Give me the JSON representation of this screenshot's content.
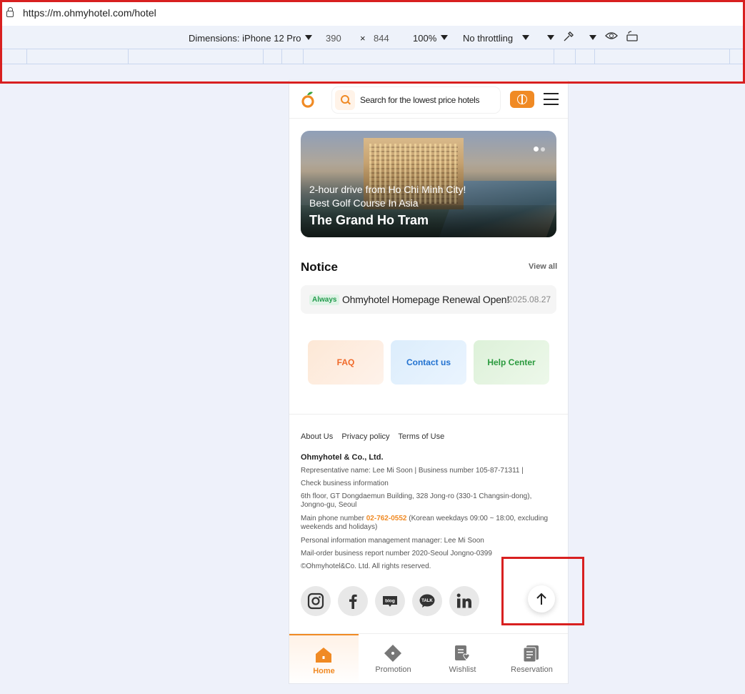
{
  "browser": {
    "url": "https://m.ohmyhotel.com/hotel"
  },
  "devtools": {
    "dimensions_label": "Dimensions: iPhone 12 Pro",
    "width": "390",
    "times": "×",
    "height": "844",
    "zoom": "100%",
    "throttling": "No throttling"
  },
  "header": {
    "search_placeholder": "Search for the lowest price hotels",
    "icons": [
      "orange-logo-icon",
      "search-icon",
      "globe-icon",
      "hamburger-menu-icon"
    ]
  },
  "banner": {
    "line1": "2-hour drive from Ho Chi Minh City!",
    "line2": "Best Golf Course In Asia",
    "title": "The Grand Ho Tram"
  },
  "notice": {
    "heading": "Notice",
    "view_all": "View all",
    "items": [
      {
        "tag": "Always",
        "title": "Ohmyhotel Homepage Renewal Open!",
        "date": "2025.08.27"
      }
    ]
  },
  "quick_links": {
    "faq": "FAQ",
    "contact": "Contact us",
    "help": "Help Center"
  },
  "footer": {
    "links": [
      "About Us",
      "Privacy policy",
      "Terms of Use"
    ],
    "company": "Ohmyhotel & Co., Ltd.",
    "rep_line": "Representative name: Lee Mi Soon  |  Business number 105-87-71311  |",
    "check_business": "Check business information",
    "address": "6th floor, GT Dongdaemun Building, 328 Jong-ro (330-1 Changsin-dong), Jongno-gu, Seoul",
    "main_phone_prefix": "Main phone number",
    "main_phone": "02-762-0552",
    "main_phone_suffix": "(Korean weekdays 09:00 ~ 18:00, excluding weekends and holidays)",
    "privacy_manager": "Personal information management manager: Lee Mi Soon",
    "mail_order": "Mail-order business report number 2020-Seoul Jongno-0399",
    "copyright": "©Ohmyhotel&Co. Ltd. All rights reserved."
  },
  "social": [
    "instagram-icon",
    "facebook-icon",
    "blog-icon",
    "kakaotalk-icon",
    "linkedin-icon"
  ],
  "social_text": {
    "blog": "blog",
    "talk": "TALK"
  },
  "bottom_nav": {
    "home": "Home",
    "promotion": "Promotion",
    "wishlist": "Wishlist",
    "reservation": "Reservation"
  },
  "colors": {
    "accent": "#f08a24",
    "annotation": "#d82020"
  }
}
